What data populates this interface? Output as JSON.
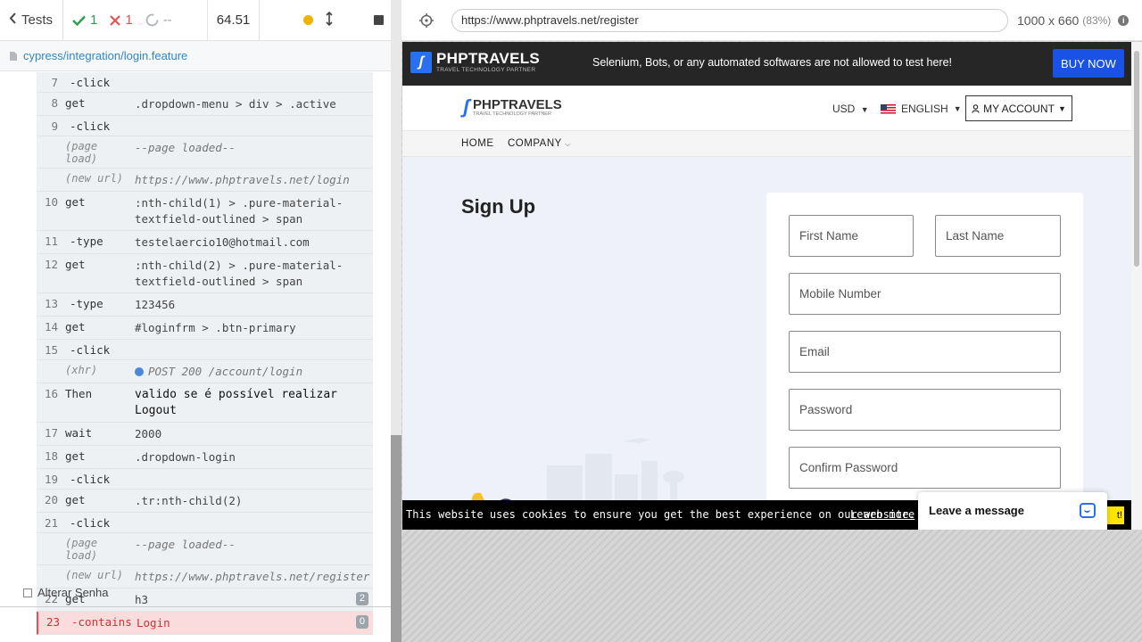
{
  "reporter": {
    "tests_label": "Tests",
    "passed": "1",
    "failed": "1",
    "pending": "--",
    "duration": "64.51",
    "spec_path": "cypress/integration/login.feature",
    "next_test": "Alterar Senha"
  },
  "commands": [
    {
      "num": "7",
      "name": "-click",
      "msg": "",
      "kind": "child"
    },
    {
      "num": "8",
      "name": "get",
      "msg": ".dropdown-menu > div > .active",
      "kind": "cmd"
    },
    {
      "num": "9",
      "name": "-click",
      "msg": "",
      "kind": "child"
    },
    {
      "num": "",
      "name": "(page load)",
      "msg": "--page loaded--",
      "kind": "event"
    },
    {
      "num": "",
      "name": "(new url)",
      "msg": "https://www.phptravels.net/login",
      "kind": "event"
    },
    {
      "num": "10",
      "name": "get",
      "msg": ":nth-child(1) > .pure-material-textfield-outlined > span",
      "kind": "cmd"
    },
    {
      "num": "11",
      "name": "-type",
      "msg": "testelaercio10@hotmail.com",
      "kind": "child"
    },
    {
      "num": "12",
      "name": "get",
      "msg": ":nth-child(2) > .pure-material-textfield-outlined > span",
      "kind": "cmd"
    },
    {
      "num": "13",
      "name": "-type",
      "msg": "123456",
      "kind": "child"
    },
    {
      "num": "14",
      "name": "get",
      "msg": "#loginfrm > .btn-primary",
      "kind": "cmd"
    },
    {
      "num": "15",
      "name": "-click",
      "msg": "",
      "kind": "child"
    },
    {
      "num": "",
      "name": "(xhr)",
      "msg": "POST 200 /account/login",
      "kind": "xhr"
    },
    {
      "num": "16",
      "name": "Then",
      "msg": "valido se é possível realizar Logout",
      "kind": "then"
    },
    {
      "num": "17",
      "name": "wait",
      "msg": "2000",
      "kind": "cmd"
    },
    {
      "num": "18",
      "name": "get",
      "msg": ".dropdown-login",
      "kind": "cmd"
    },
    {
      "num": "19",
      "name": "-click",
      "msg": "",
      "kind": "child"
    },
    {
      "num": "20",
      "name": "get",
      "msg": ".tr:nth-child(2)",
      "kind": "cmd"
    },
    {
      "num": "21",
      "name": "-click",
      "msg": "",
      "kind": "child"
    },
    {
      "num": "",
      "name": "(page load)",
      "msg": "--page loaded--",
      "kind": "event"
    },
    {
      "num": "",
      "name": "(new url)",
      "msg": "https://www.phptravels.net/register",
      "kind": "event"
    },
    {
      "num": "22",
      "name": "get",
      "msg": "h3",
      "kind": "cmd",
      "badge": "2"
    },
    {
      "num": "23",
      "name": "-contains",
      "msg": "Login",
      "kind": "failed",
      "badge": "0"
    }
  ],
  "aut": {
    "url": "https://www.phptravels.net/register",
    "viewport": "1000 x 660",
    "scale": "(83%)"
  },
  "site": {
    "logo_text": "PHPTRAVELS",
    "logo_sub": "TRAVEL TECHNOLOGY PARTNER",
    "warning": "Selenium, Bots, or any automated softwares are not allowed to test here!",
    "buy_now": "BUY NOW",
    "currency": "USD",
    "language": "ENGLISH",
    "my_account": "MY ACCOUNT",
    "nav_home": "HOME",
    "nav_company": "COMPANY",
    "page_title": "Sign Up",
    "fields": {
      "first_name": "First Name",
      "last_name": "Last Name",
      "mobile": "Mobile Number",
      "email": "Email",
      "password": "Password",
      "confirm_password": "Confirm Password"
    },
    "cookie_text": "This website uses cookies to ensure you get the best experience on our website.",
    "cookie_link": "Learn more",
    "cookie_btn": "t!",
    "chat_label": "Leave a message"
  },
  "colors": {
    "pass": "#2d9d4b",
    "fail": "#e94f4f",
    "brand_blue": "#1a52e6",
    "cookie_btn": "#ffe600"
  }
}
